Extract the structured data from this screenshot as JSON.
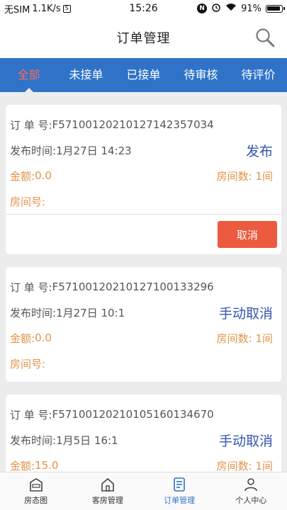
{
  "status_bar": {
    "carrier": "无SIM",
    "speed": "1.1K/s",
    "time": "15:26",
    "battery": "91%"
  },
  "header": {
    "title": "订单管理"
  },
  "tabs": [
    {
      "label": "全部",
      "active": true
    },
    {
      "label": "未接单"
    },
    {
      "label": "已接单"
    },
    {
      "label": "待审核"
    },
    {
      "label": "待评价"
    }
  ],
  "labels": {
    "order_no": "订  单  号: ",
    "publish_time": "发布时间: ",
    "amount": "金额: ",
    "room_count": "房间数: ",
    "room_no": "房间号: "
  },
  "orders": [
    {
      "order_no": "F5710012021012714235703​4",
      "publish_time": "1月27日 14:23",
      "status": "发布",
      "amount": "0.0",
      "room_count": "1间",
      "room_no": "",
      "action": "取消"
    },
    {
      "order_no": "F571001202101271001332​96",
      "publish_time": "1月27日 10:1",
      "status": "手动取消",
      "amount": "0.0",
      "room_count": "1间",
      "room_no": ""
    },
    {
      "order_no": "F571001202101051601346​70",
      "publish_time": "1月5日 16:1",
      "status": "手动取消",
      "amount": "15.0",
      "room_count": "1间",
      "room_no": ""
    }
  ],
  "bottom_nav": [
    {
      "label": "房态图",
      "icon": "hotel-icon"
    },
    {
      "label": "客房管理",
      "icon": "house-icon"
    },
    {
      "label": "订单管理",
      "icon": "order-list-icon",
      "active": true
    },
    {
      "label": "个人中心",
      "icon": "person-icon"
    }
  ],
  "colors": {
    "primary": "#2f73c9",
    "active_tab": "#ff6a55",
    "status": "#3556b0",
    "amount": "#e39349",
    "cancel": "#ec5a3f"
  }
}
